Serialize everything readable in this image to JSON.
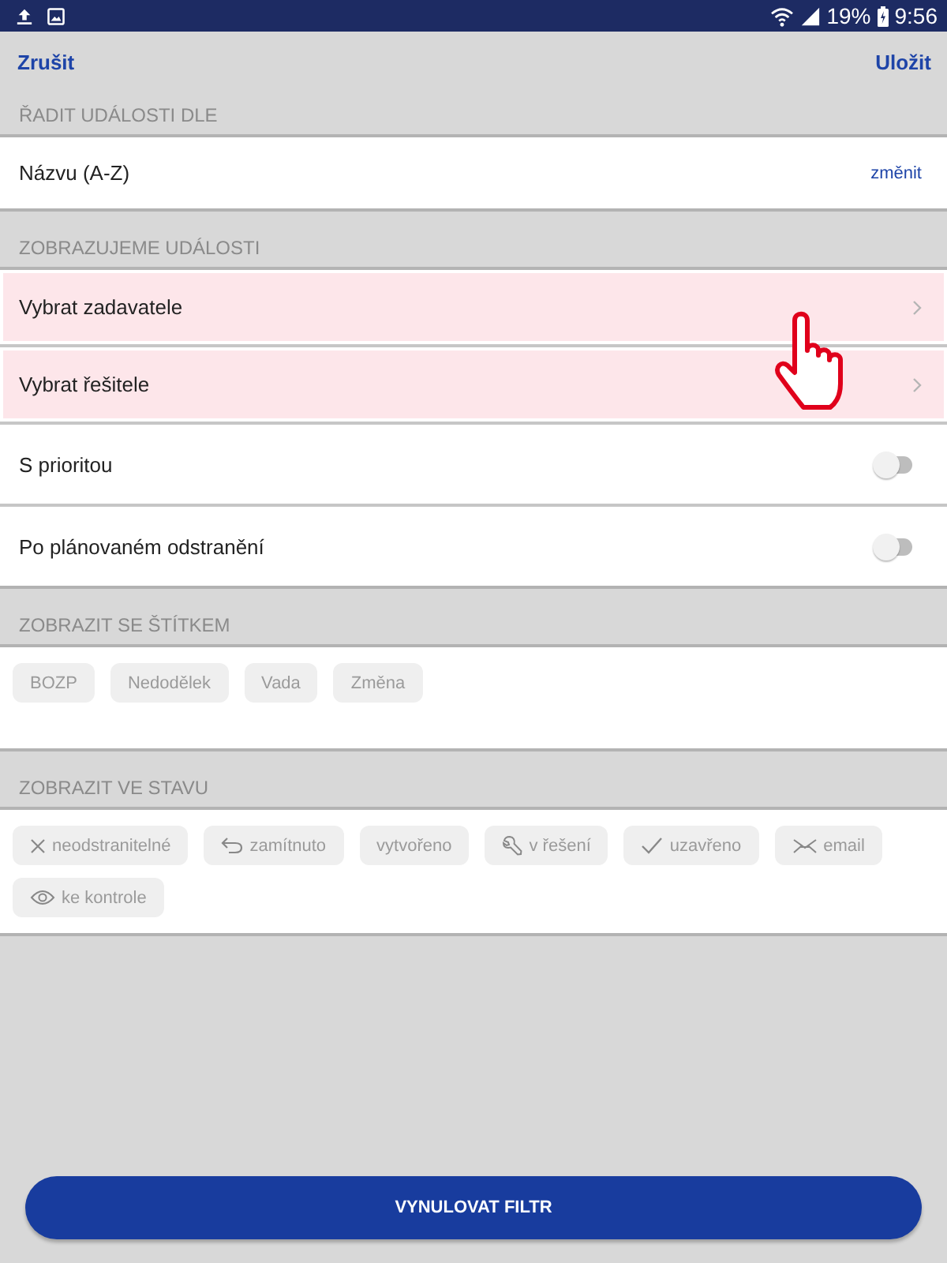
{
  "status_bar": {
    "battery": "19%",
    "time": "9:56"
  },
  "nav": {
    "cancel": "Zrušit",
    "save": "Uložit"
  },
  "sections": [
    {
      "kind": "sort",
      "title": "ŘADIT UDÁLOSTI DLE",
      "value": "Názvu (A-Z)",
      "action": "změnit"
    },
    {
      "kind": "rows",
      "title": "ZOBRAZUJEME UDÁLOSTI",
      "rows": [
        {
          "kind": "link",
          "label": "Vybrat zadavatele",
          "highlighted": true
        },
        {
          "kind": "link",
          "label": "Vybrat řešitele",
          "highlighted": true
        },
        {
          "kind": "toggle",
          "label": "S prioritou",
          "highlighted": false,
          "on": false
        },
        {
          "kind": "toggle",
          "label": "Po plánovaném odstranění",
          "highlighted": false,
          "on": false
        }
      ]
    },
    {
      "kind": "chips",
      "title": "ZOBRAZIT SE ŠTÍTKEM",
      "chips": [
        {
          "label": "BOZP",
          "selected": false
        },
        {
          "label": "Nedodělek",
          "selected": false
        },
        {
          "label": "Vada",
          "selected": false
        },
        {
          "label": "Změna",
          "selected": false
        }
      ]
    },
    {
      "kind": "chips",
      "title": "ZOBRAZIT VE STAVU",
      "chips": [
        {
          "kind": "unremovable",
          "label": "neodstranitelné",
          "selected": false
        },
        {
          "kind": "rejected",
          "label": "zamítnuto",
          "selected": false
        },
        {
          "kind": "created",
          "label": "vytvořeno",
          "selected": false
        },
        {
          "kind": "progress",
          "label": "v řešení",
          "selected": false
        },
        {
          "kind": "closed",
          "label": "uzavřeno",
          "selected": false
        },
        {
          "kind": "email",
          "label": "email",
          "selected": false
        },
        {
          "kind": "review",
          "label": "ke kontrole",
          "selected": false
        }
      ]
    }
  ],
  "reset_button": "VYNULOVAT FILTR"
}
